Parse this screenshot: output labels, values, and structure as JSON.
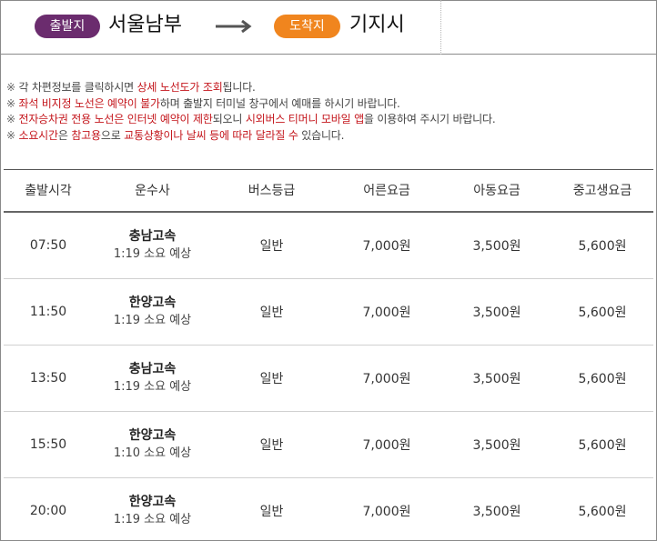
{
  "route": {
    "departure_badge": "출발지",
    "departure_name": "서울남부",
    "arrival_badge": "도착지",
    "arrival_name": "기지시",
    "colors": {
      "departure": "#6b2c6e",
      "arrival": "#f0851e"
    }
  },
  "notices": [
    {
      "parts": [
        {
          "t": "※ ",
          "hl": false
        },
        {
          "t": "각 차편정보를 클릭하시면 ",
          "hl": false
        },
        {
          "t": "상세 노선도가 조회",
          "hl": true
        },
        {
          "t": "됩니다.",
          "hl": false
        }
      ]
    },
    {
      "parts": [
        {
          "t": "※ ",
          "hl": false
        },
        {
          "t": "좌석 비지정 노선은 예약이 불가",
          "hl": true
        },
        {
          "t": "하며 출발지 터미널 창구에서 예매를 하시기 바랍니다.",
          "hl": false
        }
      ]
    },
    {
      "parts": [
        {
          "t": "※ ",
          "hl": false
        },
        {
          "t": "전자승차권 전용 노선은 인터넷 예약이 제한",
          "hl": true
        },
        {
          "t": "되오니 ",
          "hl": false
        },
        {
          "t": "시외버스 티머니 모바일 앱",
          "hl": true
        },
        {
          "t": "을 이용하여 주시기 바랍니다.",
          "hl": false
        }
      ]
    },
    {
      "parts": [
        {
          "t": "※ ",
          "hl": false
        },
        {
          "t": "소요시간",
          "hl": true
        },
        {
          "t": "은 ",
          "hl": false
        },
        {
          "t": "참고용",
          "hl": true
        },
        {
          "t": "으로 ",
          "hl": false
        },
        {
          "t": "교통상황이나 날씨 등에 따라 달라질 수",
          "hl": true
        },
        {
          "t": " 있습니다.",
          "hl": false
        }
      ]
    }
  ],
  "table": {
    "headers": [
      "출발시각",
      "운수사",
      "버스등급",
      "어른요금",
      "아동요금",
      "중고생요금"
    ],
    "rows": [
      {
        "time": "07:50",
        "company": "충남고속",
        "duration": "1:19 소요 예상",
        "grade": "일반",
        "adult": "7,000원",
        "child": "3,500원",
        "teen": "5,600원"
      },
      {
        "time": "11:50",
        "company": "한양고속",
        "duration": "1:19 소요 예상",
        "grade": "일반",
        "adult": "7,000원",
        "child": "3,500원",
        "teen": "5,600원"
      },
      {
        "time": "13:50",
        "company": "충남고속",
        "duration": "1:19 소요 예상",
        "grade": "일반",
        "adult": "7,000원",
        "child": "3,500원",
        "teen": "5,600원"
      },
      {
        "time": "15:50",
        "company": "한양고속",
        "duration": "1:10 소요 예상",
        "grade": "일반",
        "adult": "7,000원",
        "child": "3,500원",
        "teen": "5,600원"
      },
      {
        "time": "20:00",
        "company": "한양고속",
        "duration": "1:19 소요 예상",
        "grade": "일반",
        "adult": "7,000원",
        "child": "3,500원",
        "teen": "5,600원"
      }
    ]
  }
}
